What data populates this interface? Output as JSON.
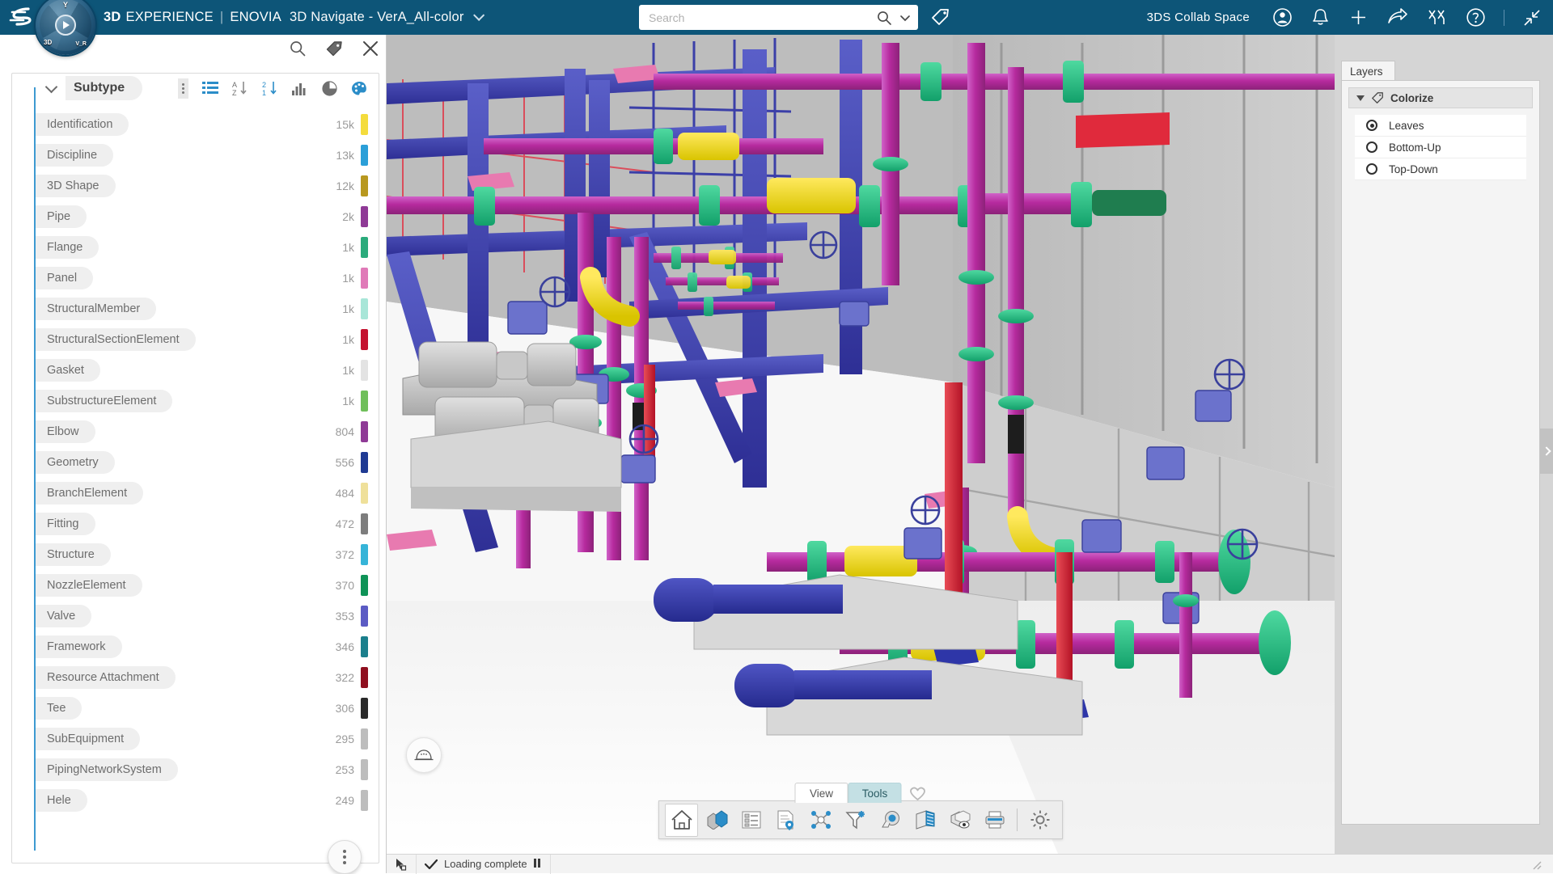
{
  "app": {
    "brand_bold": "3D",
    "brand_rest": "EXPERIENCE",
    "separator": "|",
    "product": "ENOVIA",
    "context_title": "3D Navigate - VerA_All-color"
  },
  "header": {
    "search_placeholder": "Search",
    "search_value": "",
    "collab_space": "3DS Collab Space",
    "icons": [
      "search-icon",
      "chevron-down-icon",
      "tag-icon",
      "user-account-icon",
      "notification-bell-icon",
      "add-icon",
      "share-icon",
      "communities-icon",
      "help-icon",
      "collapse-icon"
    ]
  },
  "left_panel": {
    "tools": [
      "search-icon",
      "tag-icon",
      "close-icon"
    ],
    "facet_title": "Subtype",
    "toolbar_icons": [
      "more-options-icon",
      "list-view-icon",
      "sort-az-icon",
      "sort-numeric-icon",
      "bar-chart-icon",
      "pie-chart-icon",
      "palette-icon"
    ],
    "facets": [
      {
        "label": "Identification",
        "count": "15k",
        "color": "#f4dc3c"
      },
      {
        "label": "Discipline",
        "count": "13k",
        "color": "#2b9fd8"
      },
      {
        "label": "3D Shape",
        "count": "12k",
        "color": "#b8981f"
      },
      {
        "label": "Pipe",
        "count": "2k",
        "color": "#8f3a96"
      },
      {
        "label": "Flange",
        "count": "1k",
        "color": "#2bab7c"
      },
      {
        "label": "Panel",
        "count": "1k",
        "color": "#e07ab8"
      },
      {
        "label": "StructuralMember",
        "count": "1k",
        "color": "#a8e6d8"
      },
      {
        "label": "StructuralSectionElement",
        "count": "1k",
        "color": "#c4122f"
      },
      {
        "label": "Gasket",
        "count": "1k",
        "color": "#e3e3e3"
      },
      {
        "label": "SubstructureElement",
        "count": "1k",
        "color": "#6fbf5a"
      },
      {
        "label": "Elbow",
        "count": "804",
        "color": "#8f3a96"
      },
      {
        "label": "Geometry",
        "count": "556",
        "color": "#1f3a93"
      },
      {
        "label": "BranchElement",
        "count": "484",
        "color": "#efe09a"
      },
      {
        "label": "Fitting",
        "count": "472",
        "color": "#7d7d7d"
      },
      {
        "label": "Structure",
        "count": "372",
        "color": "#36b4d8"
      },
      {
        "label": "NozzleElement",
        "count": "370",
        "color": "#0f9357"
      },
      {
        "label": "Valve",
        "count": "353",
        "color": "#5b5bc4"
      },
      {
        "label": "Framework",
        "count": "346",
        "color": "#1b7f8c"
      },
      {
        "label": "Resource Attachment",
        "count": "322",
        "color": "#8f0f1f"
      },
      {
        "label": "Tee",
        "count": "306",
        "color": "#2a2a2a"
      },
      {
        "label": "SubEquipment",
        "count": "295",
        "color": "#bdbdbd"
      },
      {
        "label": "PipingNetworkSystem",
        "count": "253",
        "color": "#bdbdbd"
      },
      {
        "label": "Hele",
        "count": "249",
        "color": "#bdbdbd"
      }
    ],
    "more_button": "more-actions-fab"
  },
  "viewport": {
    "hardhat_icon": "hard-hat-icon",
    "tabs": [
      {
        "label": "View",
        "active": false
      },
      {
        "label": "Tools",
        "active": true
      }
    ],
    "favorite_icon": "heart-icon",
    "toolbar": [
      {
        "name": "home-icon",
        "selected": true
      },
      {
        "name": "product-structure-icon",
        "selected": false
      },
      {
        "name": "list-properties-icon",
        "selected": false
      },
      {
        "name": "document-location-icon",
        "selected": false
      },
      {
        "name": "relations-graph-icon",
        "selected": false
      },
      {
        "name": "filter-icon",
        "selected": false
      },
      {
        "name": "measure-tape-icon",
        "selected": false
      },
      {
        "name": "section-view-icon",
        "selected": false
      },
      {
        "name": "visibility-icon",
        "selected": false
      },
      {
        "name": "print-icon",
        "selected": false
      },
      {
        "name": "settings-gear-icon",
        "selected": false
      }
    ]
  },
  "right_panel": {
    "tab": "Layers",
    "group_title": "Colorize",
    "group_icon": "tag-icon",
    "options": [
      {
        "label": "Leaves",
        "selected": true
      },
      {
        "label": "Bottom-Up",
        "selected": false
      },
      {
        "label": "Top-Down",
        "selected": false
      }
    ],
    "collapse_icon": "chevron-right-icon"
  },
  "status_bar": {
    "cursor_icon": "select-cursor-icon",
    "check_icon": "check-icon",
    "message": "Loading complete",
    "pause_icon": "pause-icon",
    "resize_icon": "resize-grip-icon"
  },
  "colors": {
    "brand_blue": "#0d5578",
    "accent_blue": "#3d9ad1",
    "panel_gray": "#d5d5d5",
    "active_tab": "#c4e0e4"
  }
}
